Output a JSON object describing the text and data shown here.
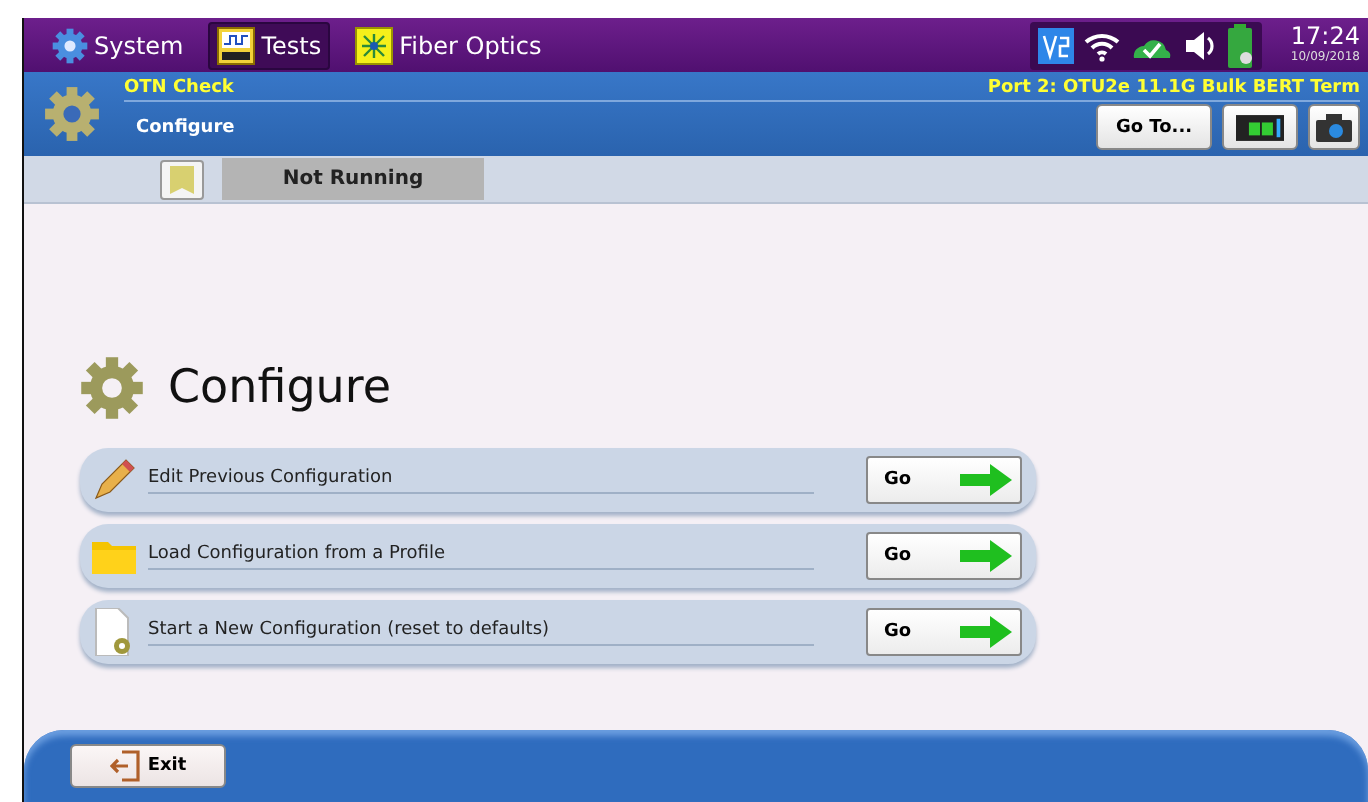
{
  "top_bar": {
    "tabs": [
      {
        "label": "System",
        "selected": false,
        "kind": "system"
      },
      {
        "label": "Tests",
        "selected": true,
        "kind": "tests"
      },
      {
        "label": "Fiber Optics",
        "selected": false,
        "kind": "fiber"
      }
    ],
    "time": "17:24",
    "date": "10/09/2018"
  },
  "header": {
    "test_name": "OTN Check",
    "port": "Port 2: OTU2e 11.1G Bulk BERT Term",
    "page": "Configure",
    "goto_button": "Go To..."
  },
  "status": {
    "state": "Not Running"
  },
  "section": {
    "title": "Configure",
    "options": [
      {
        "label": "Edit Previous Configuration",
        "kind": "edit",
        "button": "Go"
      },
      {
        "label": "Load Configuration from a Profile",
        "kind": "load",
        "button": "Go"
      },
      {
        "label": "Start a New Configuration (reset to defaults)",
        "kind": "new",
        "button": "Go"
      }
    ]
  },
  "footer": {
    "exit_button": "Exit"
  }
}
